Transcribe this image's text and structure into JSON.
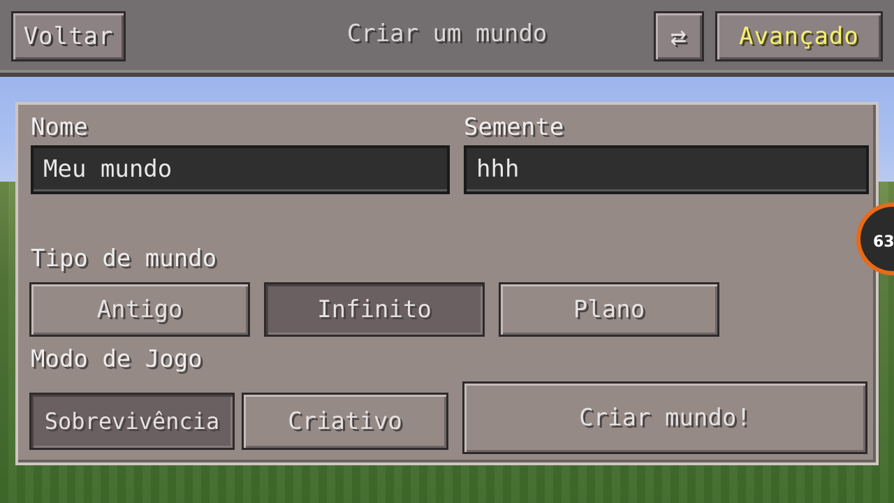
{
  "topbar": {
    "back_label": "Voltar",
    "title": "Criar um mundo",
    "swap_icon": "⇄",
    "advanced_label": "Avançado"
  },
  "form": {
    "name_label": "Nome",
    "name_value": "Meu mundo",
    "seed_label": "Semente",
    "seed_value": "hhh",
    "world_type_label": "Tipo de mundo",
    "world_types": [
      {
        "label": "Antigo",
        "selected": false
      },
      {
        "label": "Infinito",
        "selected": true
      },
      {
        "label": "Plano",
        "selected": false
      }
    ],
    "game_mode_label": "Modo de Jogo",
    "game_modes": [
      {
        "label": "Sobrevivência",
        "selected": true
      },
      {
        "label": "Criativo",
        "selected": false
      }
    ],
    "create_label": "Criar mundo!"
  },
  "overlay": {
    "counter": "63",
    "ring_color": "#e86a18"
  },
  "colors": {
    "advanced_text": "#f4f070",
    "panel": "#958a86",
    "selected_option": "#6a5f61"
  }
}
